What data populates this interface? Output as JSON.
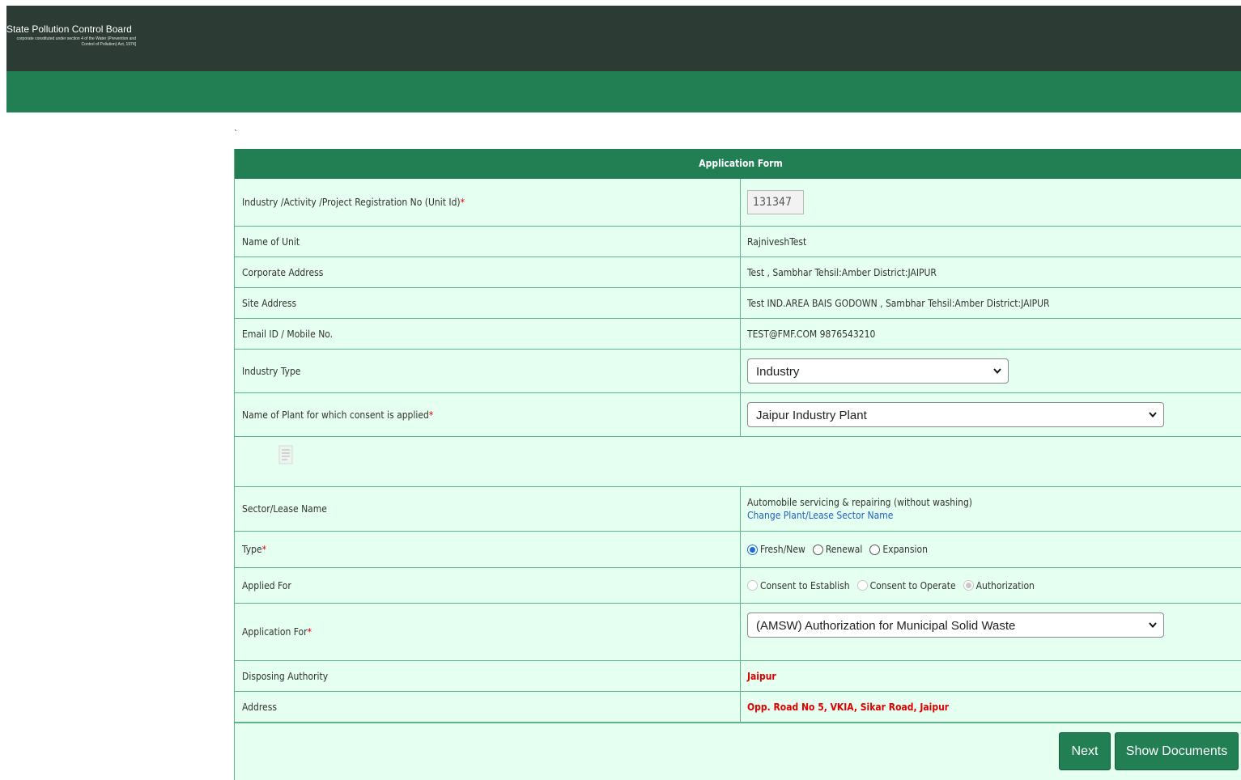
{
  "header": {
    "title": "State Pollution Control Board",
    "subtitle": "corporate constituted under section 4 of the Water (Prevention and Control of Pollution) Act, 1974]"
  },
  "misc": {
    "tick": "`"
  },
  "form": {
    "title": "Application Form",
    "unit_id": {
      "label": "Industry /Activity /Project Registration No (Unit Id)",
      "required_mark": "*",
      "value": "131347"
    },
    "unit_name": {
      "label": "Name of Unit",
      "value": "RajniveshTest"
    },
    "corporate_address": {
      "label": "Corporate Address",
      "value": "Test , Sambhar Tehsil:Amber District:JAIPUR"
    },
    "site_address": {
      "label": "Site Address",
      "value": "Test IND.AREA BAIS GODOWN , Sambhar Tehsil:Amber District:JAIPUR"
    },
    "contact": {
      "label": "Email ID / Mobile No.",
      "value": "TEST@FMF.COM 9876543210"
    },
    "industry_type": {
      "label": "Industry Type",
      "selected": "Industry"
    },
    "plant": {
      "label": "Name of Plant for which consent is applied ",
      "required_mark": "*",
      "selected": "Jaipur Industry Plant"
    },
    "sector": {
      "label": "Sector/Lease Name",
      "value": "Automobile servicing & repairing (without washing)",
      "link": "Change Plant/Lease Sector Name"
    },
    "type": {
      "label": "Type",
      "required_mark": "*",
      "options": [
        "Fresh/New",
        "Renewal",
        "Expansion"
      ],
      "selected": "Fresh/New"
    },
    "applied_for": {
      "label": "Applied For",
      "options": [
        "Consent to Establish",
        "Consent to Operate",
        "Authorization"
      ],
      "selected": "Authorization"
    },
    "application_for": {
      "label": "Application For",
      "required_mark": "*",
      "selected": "(AMSW) Authorization for Municipal Solid Waste"
    },
    "disposing_authority": {
      "label": "Disposing Authority",
      "value": "Jaipur"
    },
    "address": {
      "label": "Address",
      "value": "Opp. Road No 5, VKIA, Sikar Road, Jaipur"
    }
  },
  "buttons": {
    "next": "Next",
    "show_documents": "Show Documents"
  }
}
